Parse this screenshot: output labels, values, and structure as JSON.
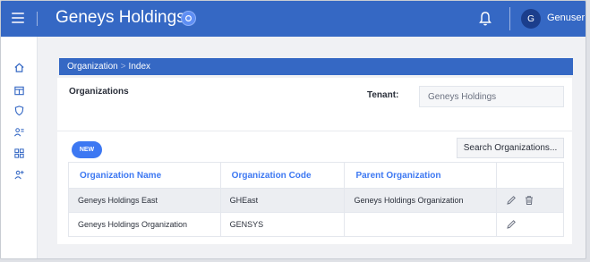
{
  "header": {
    "app_title": "Geneys Holdings",
    "avatar_initial": "G",
    "username": "Genuser"
  },
  "sidebar": {
    "icons": [
      "home-icon",
      "table-icon",
      "shield-icon",
      "users-icon",
      "grid-icon",
      "user-settings-icon"
    ]
  },
  "breadcrumb": {
    "section": "Organization",
    "page": "Index",
    "separator": ">"
  },
  "card": {
    "title": "Organizations",
    "tenant_label": "Tenant:",
    "tenant_value": "Geneys Holdings",
    "new_label": "NEW",
    "search_label": "Search Organizations..."
  },
  "table": {
    "columns": [
      "Organization Name",
      "Organization Code",
      "Parent Organization",
      ""
    ],
    "rows": [
      {
        "name": "Geneys Holdings East",
        "code": "GHEast",
        "parent": "Geneys Holdings Organization",
        "actions": [
          "edit-icon",
          "delete-icon"
        ]
      },
      {
        "name": "Geneys Holdings Organization",
        "code": "GENSYS",
        "parent": "",
        "actions": [
          "edit-icon"
        ]
      }
    ]
  },
  "colors": {
    "primary": "#3568c4",
    "accent": "#3d78f2",
    "avatar": "#1b3e8c"
  }
}
